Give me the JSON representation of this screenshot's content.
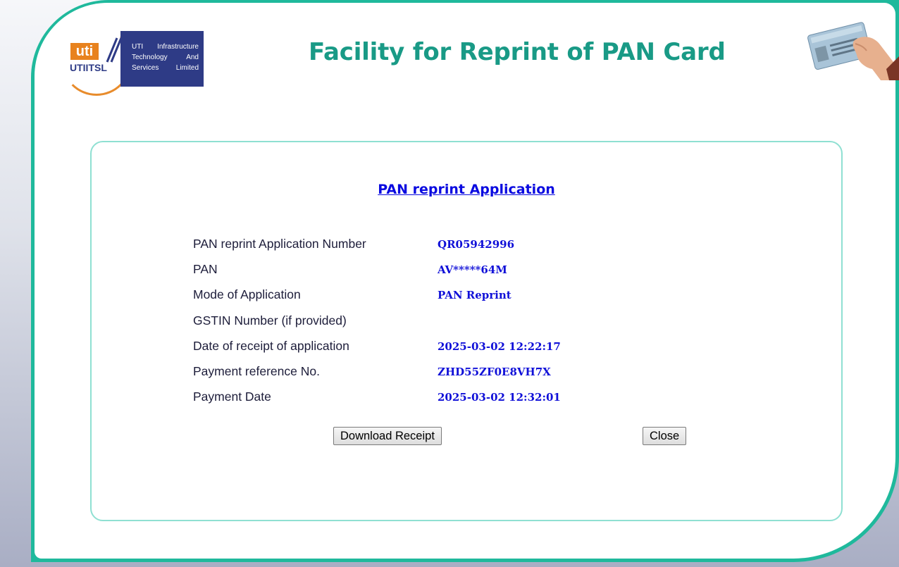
{
  "header": {
    "title": "Facility for Reprint of PAN Card",
    "logo": {
      "mark": "uti",
      "short_name": "UTIITSL",
      "company_line1": "UTI Infrastructure",
      "company_line2": "Technology And",
      "company_line3": "Services Limited"
    },
    "card_image_icon": "pan-card-in-hand-icon"
  },
  "panel": {
    "heading": "PAN reprint Application",
    "rows": [
      {
        "label": "PAN reprint Application Number",
        "value": "QR05942996"
      },
      {
        "label": "PAN",
        "value": "AV*****64M"
      },
      {
        "label": "Mode of Application",
        "value": "PAN Reprint"
      },
      {
        "label": "GSTIN Number (if provided)",
        "value": ""
      },
      {
        "label": "Date of receipt of application",
        "value": "2025-03-02 12:22:17"
      },
      {
        "label": "Payment reference No.",
        "value": "ZHD55ZF0E8VH7X"
      },
      {
        "label": "Payment Date",
        "value": "2025-03-02 12:32:01"
      }
    ],
    "buttons": {
      "download": "Download Receipt",
      "close": "Close"
    }
  },
  "colors": {
    "frame": "#1fb99c",
    "title": "#199a86",
    "value_text": "#1010d8",
    "panel_border": "#8fe0d2",
    "logo_blue": "#2e3b86",
    "logo_orange": "#e8821e"
  }
}
